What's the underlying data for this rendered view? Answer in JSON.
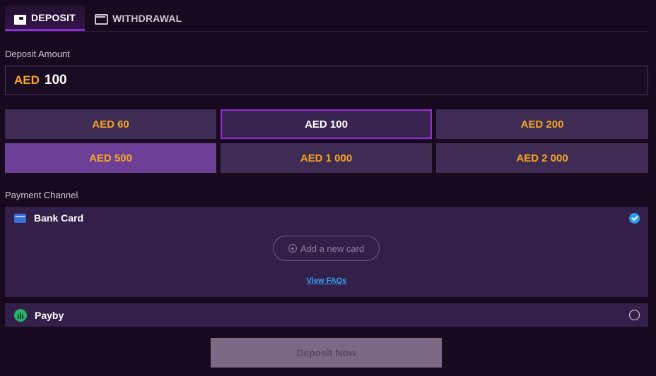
{
  "tabs": [
    {
      "label": "DEPOSIT",
      "icon": "wallet-icon",
      "active": true
    },
    {
      "label": "WITHDRAWAL",
      "icon": "card-icon",
      "active": false
    }
  ],
  "deposit_amount": {
    "label": "Deposit Amount",
    "currency": "AED",
    "value": "100"
  },
  "presets": [
    {
      "label": "AED 60"
    },
    {
      "label": "AED 100",
      "state": "selected"
    },
    {
      "label": "AED 200"
    },
    {
      "label": "AED 500",
      "state": "highlighted"
    },
    {
      "label": "AED 1 000"
    },
    {
      "label": "AED 2 000"
    }
  ],
  "payment_channel": {
    "label": "Payment Channel",
    "options": [
      {
        "name": "Bank Card",
        "icon": "bank-card-icon",
        "selected": true
      },
      {
        "name": "Payby",
        "icon": "payby-icon",
        "selected": false
      }
    ],
    "add_card_label": "Add a new card",
    "faq_label": "View FAQs"
  },
  "submit_label": "Deposit Now",
  "colors": {
    "background": "#170a1f",
    "accent_purple": "#8a2bd8",
    "amount_orange": "#f5a623",
    "link_blue": "#3aa0f2"
  }
}
